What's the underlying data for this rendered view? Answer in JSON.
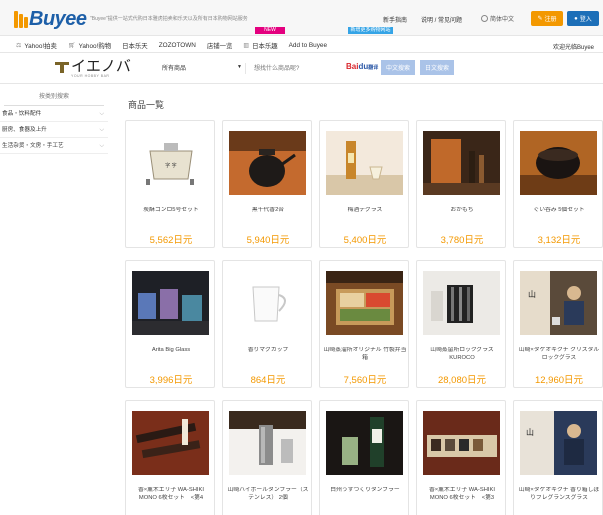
{
  "header": {
    "logo_text": "Buyee",
    "tagline": "\"Buyee\"提供一站式代购日本雅虎拍卖和乐天以及所有日本购物网站服务",
    "links": [
      "新手指南",
      "说明 / 常见问题"
    ],
    "link_sep": "/",
    "language": "简体中文",
    "register_label": "注册",
    "login_label": "登入"
  },
  "nav": {
    "items": [
      {
        "label": "Yahoo!拍卖",
        "icon": "auction-icon"
      },
      {
        "label": "Yahoo!购物",
        "icon": "cart-icon"
      },
      {
        "label": "日本乐天",
        "icon": ""
      },
      {
        "label": "ZOZOTOWN",
        "icon": ""
      },
      {
        "label": "店铺一览",
        "icon": ""
      },
      {
        "label": "日本乐趣",
        "icon": "store-icon"
      },
      {
        "label": "Add to Buyee",
        "icon": ""
      }
    ],
    "badge_new": "NEW",
    "badge_blue": "新增更多购物网站",
    "right_text": "欢迎光临Buyee"
  },
  "search": {
    "shop_name": "イエノバ",
    "shop_sub": "YOUR HOBBY BAR",
    "category_value": "所有商品",
    "placeholder": "想找什么商品呢?",
    "baidu_text": "Bai",
    "baidu_du": "du",
    "baidu_small": "翻译",
    "btn_cn": "中文搜索",
    "btn_jp": "日文搜索"
  },
  "sidebar": {
    "title": "按类别搜索",
    "items": [
      {
        "label": "食品・饮料配件"
      },
      {
        "label": "厨房、食器及上升"
      },
      {
        "label": "生活杂货・文房・手工艺"
      }
    ]
  },
  "main": {
    "title": "商品一覧",
    "products": [
      {
        "name": "炭酥コンロ5号セット",
        "price": "5,562日元"
      },
      {
        "name": "黒千代香2合",
        "price": "5,940日元"
      },
      {
        "name": "梅酒デグラス",
        "price": "5,400日元"
      },
      {
        "name": "おかもち",
        "price": "3,780日元"
      },
      {
        "name": "ぐい呑み 5個セット",
        "price": "3,132日元"
      },
      {
        "name": "Arita Big Glass",
        "price": "3,996日元"
      },
      {
        "name": "香りマグカップ",
        "price": "864日元"
      },
      {
        "name": "山崎蒸溜所オリジナル 竹製弁当箱",
        "price": "7,560日元"
      },
      {
        "name": "山崎蒸留所ロックグラス KUROCO",
        "price": "28,080日元"
      },
      {
        "name": "山崎×タケオキクチ クリスタルロックグラス",
        "price": "12,960日元"
      },
      {
        "name": "香×薫木エリ子 WA-SHIKI MONO 6枚セット　<第4",
        "price": ""
      },
      {
        "name": "山崎ハイボールタンブラー（ステンレス） 2個",
        "price": ""
      },
      {
        "name": "白州うすづくりタンブラー",
        "price": ""
      },
      {
        "name": "香×薫木エリ子 WA-SHIKI MONO 6枚セット　<第3",
        "price": ""
      },
      {
        "name": "山崎×タケオキクチ 香り箱しぼりフレグランスグラス",
        "price": ""
      }
    ]
  },
  "colors": {
    "accent": "#f39800",
    "brand": "#1d5fa8",
    "login": "#1d6fb8",
    "badge_new": "#e4007f"
  }
}
